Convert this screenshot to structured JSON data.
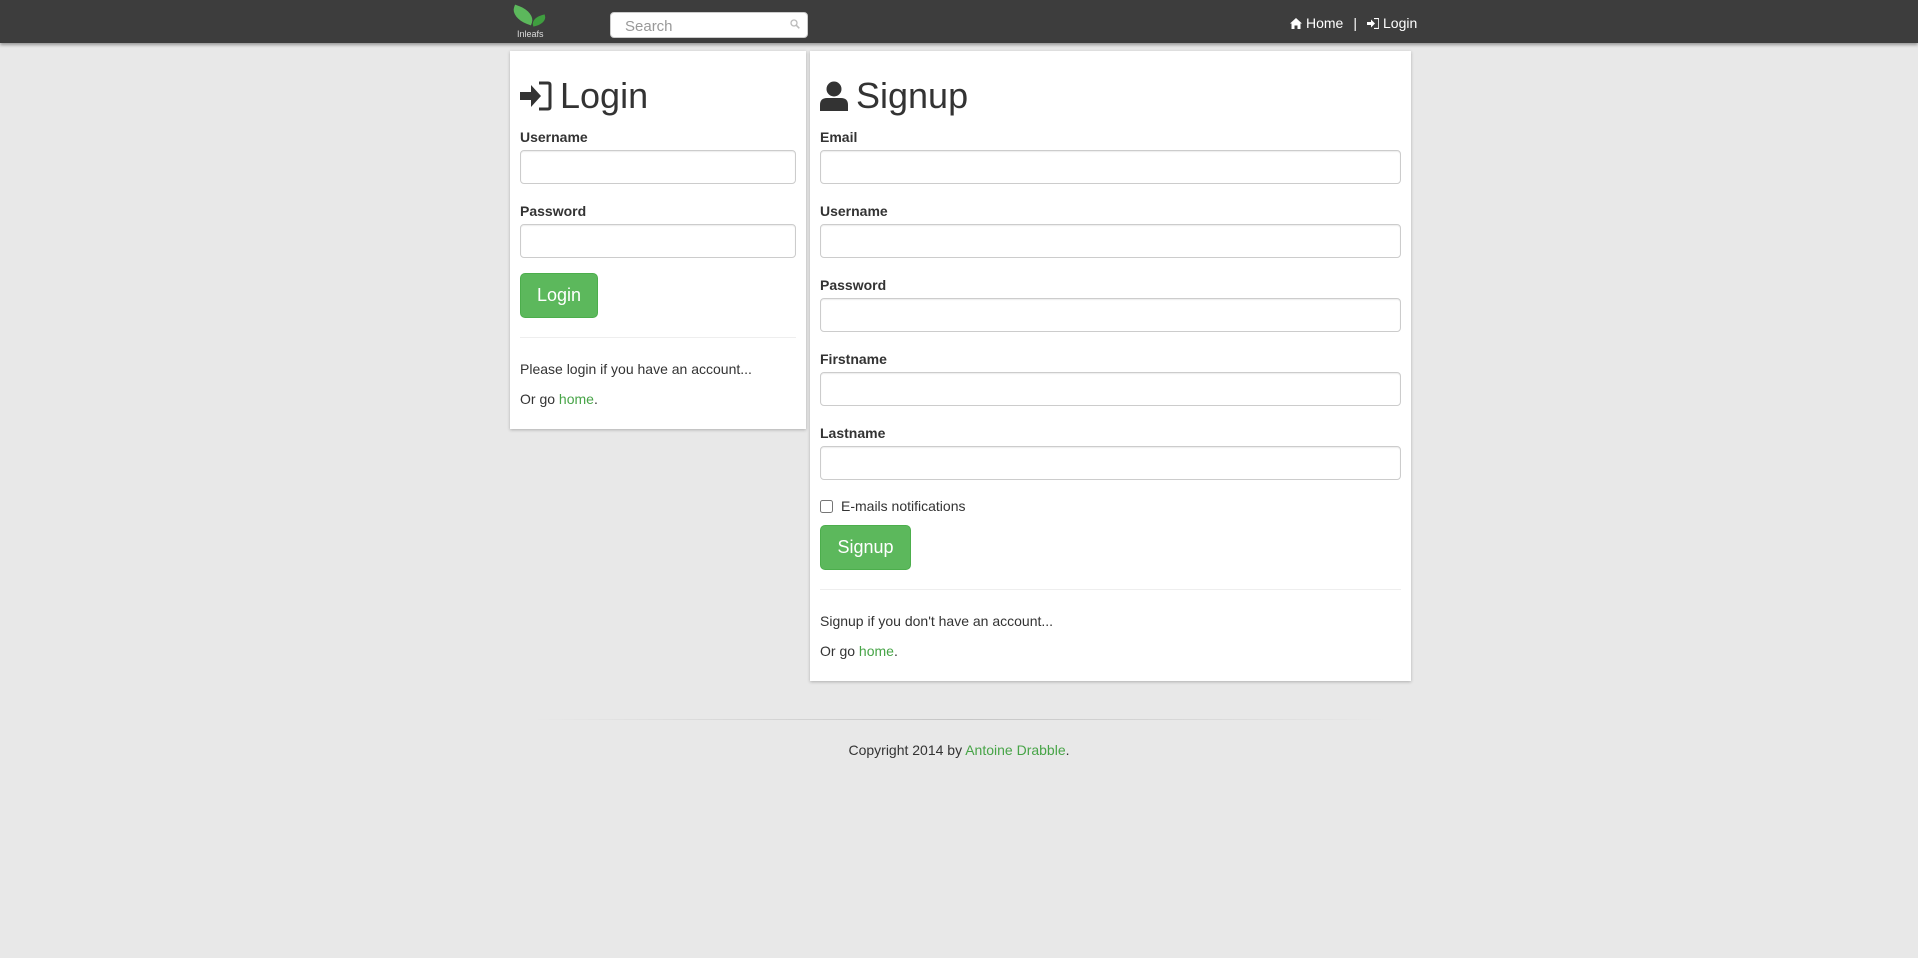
{
  "navbar": {
    "logo_text": "Inleafs",
    "search_placeholder": "Search",
    "home_label": "Home",
    "separator": "|",
    "login_label": "Login"
  },
  "login": {
    "title": "Login",
    "username_label": "Username",
    "password_label": "Password",
    "button_label": "Login",
    "note": "Please login if you have an account...",
    "go_prefix": "Or go ",
    "go_link": "home",
    "go_suffix": "."
  },
  "signup": {
    "title": "Signup",
    "email_label": "Email",
    "username_label": "Username",
    "password_label": "Password",
    "firstname_label": "Firstname",
    "lastname_label": "Lastname",
    "notifications_label": "E-mails notifications",
    "notifications_checked": false,
    "button_label": "Signup",
    "note": "Signup if you don't have an account...",
    "go_prefix": "Or go ",
    "go_link": "home",
    "go_suffix": "."
  },
  "footer": {
    "prefix": "Copyright 2014 by ",
    "author": "Antoine Drabble",
    "suffix": "."
  },
  "colors": {
    "navbar": "#3d3d3d",
    "accent_green": "#5cb85c",
    "link_green": "#47a447",
    "background": "#e8e8e8"
  },
  "icons": [
    "home-icon",
    "sign-in-icon",
    "user-icon",
    "search-icon"
  ]
}
